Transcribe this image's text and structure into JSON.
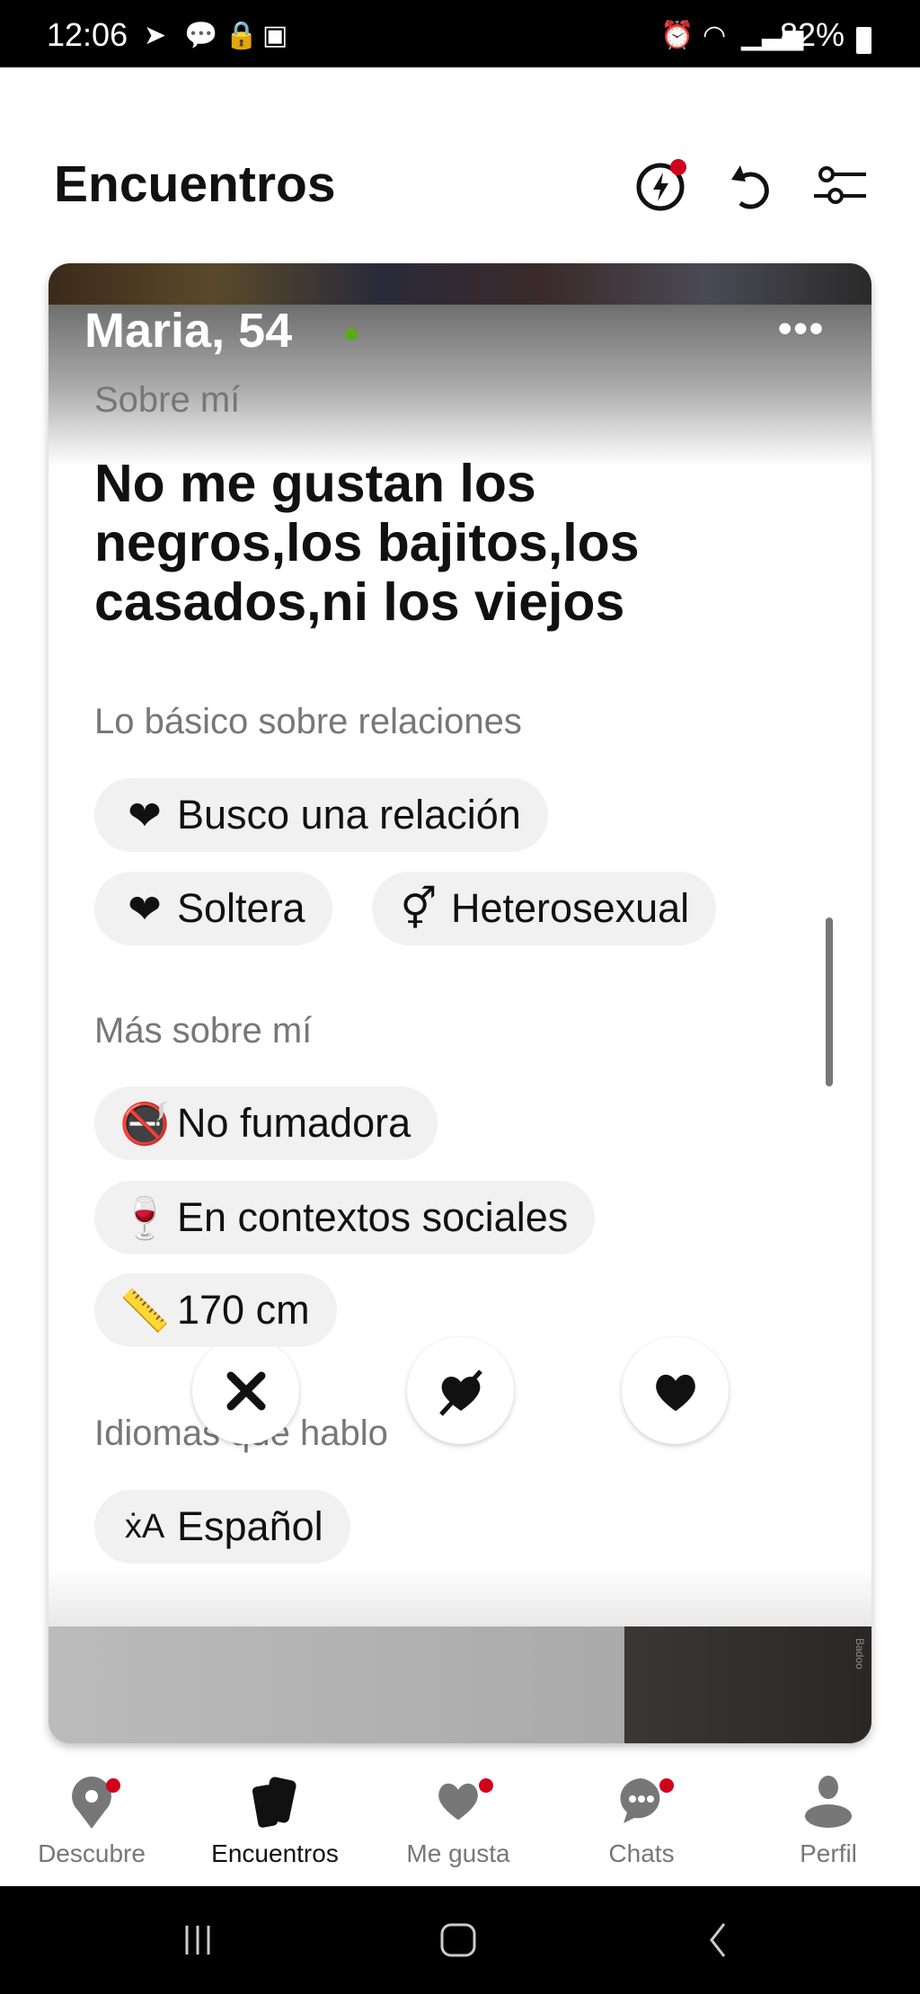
{
  "status_bar": {
    "time": "12:06",
    "battery": "82%"
  },
  "header": {
    "title": "Encuentros",
    "icons": [
      "boost-icon",
      "undo-icon",
      "filters-icon"
    ],
    "boost_badge": true
  },
  "profile": {
    "name_age": "Maria, 54",
    "online": true,
    "about_label": "Sobre mí",
    "bio": "No me gustan los negros,los bajitos,los casados,ni los viejos",
    "relations_label": "Lo básico sobre relaciones",
    "relations": [
      {
        "icon": "heart-icon",
        "label": "Busco una relación"
      },
      {
        "icon": "heart-icon",
        "label": "Soltera"
      },
      {
        "icon": "gender-icon",
        "label": "Heterosexual"
      }
    ],
    "more_label": "Más sobre mí",
    "more": [
      {
        "icon": "no-smoking-icon",
        "label": "No fumadora"
      },
      {
        "icon": "wine-glass-icon",
        "label": "En contextos sociales"
      },
      {
        "icon": "ruler-icon",
        "label": "170 cm"
      }
    ],
    "languages_label": "Idiomas que hablo",
    "languages": [
      {
        "icon": "translate-icon",
        "label": "Español"
      }
    ],
    "watermark": "Badoo"
  },
  "actions": [
    "close-icon",
    "crush-icon",
    "heart-icon"
  ],
  "nav": [
    {
      "label": "Descubre",
      "badge": true
    },
    {
      "label": "Encuentros",
      "active": true
    },
    {
      "label": "Me gusta",
      "badge": true
    },
    {
      "label": "Chats",
      "badge": true
    },
    {
      "label": "Perfil"
    }
  ],
  "colors": {
    "accent": "#d0021b",
    "online": "#5aab17"
  }
}
